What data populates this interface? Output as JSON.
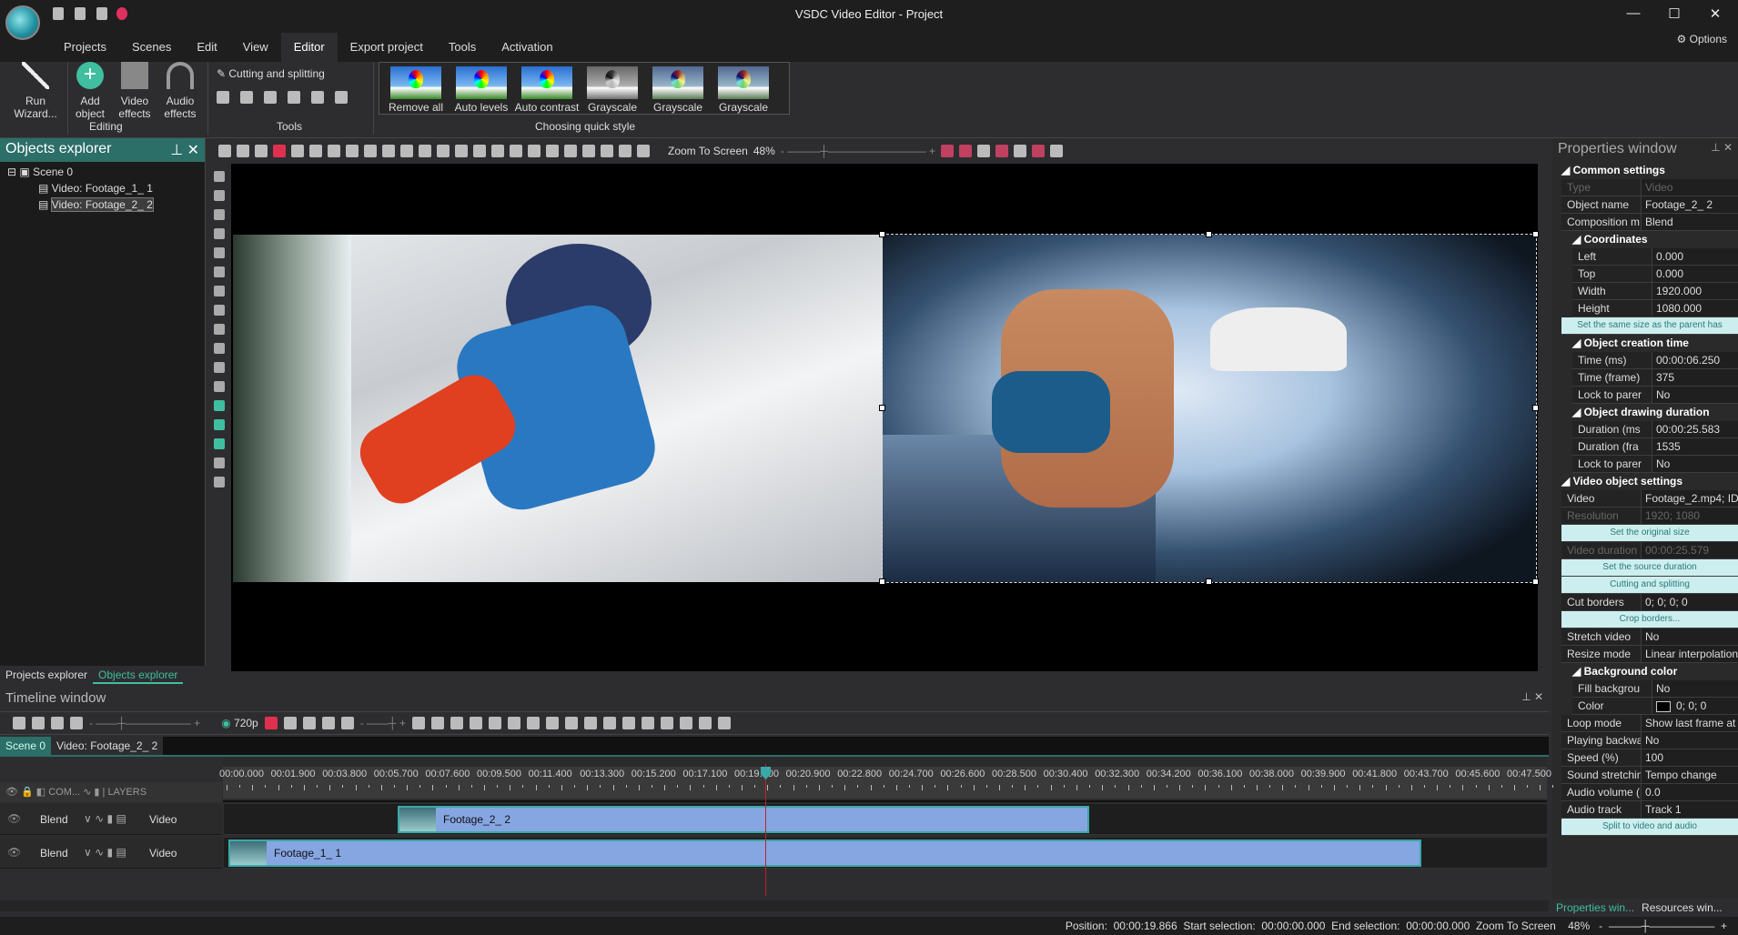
{
  "app": {
    "title": "VSDC Video Editor - Project",
    "options": "Options"
  },
  "menu": [
    "Projects",
    "Scenes",
    "Edit",
    "View",
    "Editor",
    "Export project",
    "Tools",
    "Activation"
  ],
  "menu_active": "Editor",
  "ribbon": {
    "run_wizard": "Run Wizard...",
    "add_object": "Add object",
    "video_effects": "Video effects",
    "audio_effects": "Audio effects",
    "editing": "Editing",
    "cutting": "Cutting and splitting",
    "tools": "Tools",
    "quick_styles": [
      "Remove all",
      "Auto levels",
      "Auto contrast",
      "Grayscale",
      "Grayscale",
      "Grayscale"
    ],
    "choosing": "Choosing quick style"
  },
  "objects_explorer": {
    "title": "Objects explorer",
    "tree": [
      "Scene 0",
      "Video: Footage_1_ 1",
      "Video: Footage_2_ 2"
    ],
    "tabs": [
      "Projects explorer",
      "Objects explorer"
    ]
  },
  "canvas_toolbar": {
    "zoom_label": "Zoom To Screen",
    "zoom": "48%"
  },
  "properties": {
    "title": "Properties window",
    "rows": [
      {
        "t": "sec",
        "l": "Common settings",
        "i": 0
      },
      {
        "t": "row",
        "k": "Type",
        "v": "Video",
        "dis": true,
        "i": 1
      },
      {
        "t": "row",
        "k": "Object name",
        "v": "Footage_2_ 2",
        "i": 1
      },
      {
        "t": "row",
        "k": "Composition m",
        "v": "Blend",
        "i": 1
      },
      {
        "t": "sec",
        "l": "Coordinates",
        "i": 1
      },
      {
        "t": "row",
        "k": "Left",
        "v": "0.000",
        "i": 2
      },
      {
        "t": "row",
        "k": "Top",
        "v": "0.000",
        "i": 2
      },
      {
        "t": "row",
        "k": "Width",
        "v": "1920.000",
        "i": 2
      },
      {
        "t": "row",
        "k": "Height",
        "v": "1080.000",
        "i": 2
      },
      {
        "t": "btn",
        "l": "Set the same size as the parent has"
      },
      {
        "t": "sec",
        "l": "Object creation time",
        "i": 1
      },
      {
        "t": "row",
        "k": "Time (ms)",
        "v": "00:00:06.250",
        "i": 2
      },
      {
        "t": "row",
        "k": "Time (frame)",
        "v": "375",
        "i": 2
      },
      {
        "t": "row",
        "k": "Lock to parer",
        "v": "No",
        "i": 2
      },
      {
        "t": "sec",
        "l": "Object drawing duration",
        "i": 1
      },
      {
        "t": "row",
        "k": "Duration (ms",
        "v": "00:00:25.583",
        "i": 2
      },
      {
        "t": "row",
        "k": "Duration (fra",
        "v": "1535",
        "i": 2
      },
      {
        "t": "row",
        "k": "Lock to parer",
        "v": "No",
        "i": 2
      },
      {
        "t": "sec",
        "l": "Video object settings",
        "i": 0
      },
      {
        "t": "row",
        "k": "Video",
        "v": "Footage_2.mp4; ID",
        "i": 1
      },
      {
        "t": "row",
        "k": "Resolution",
        "v": "1920; 1080",
        "dis": true,
        "i": 1
      },
      {
        "t": "btn",
        "l": "Set the original size"
      },
      {
        "t": "row",
        "k": "Video duration",
        "v": "00:00:25.579",
        "dis": true,
        "i": 1
      },
      {
        "t": "btn",
        "l": "Set the source duration"
      },
      {
        "t": "btn",
        "l": "Cutting and splitting"
      },
      {
        "t": "row",
        "k": "Cut borders",
        "v": "0; 0; 0; 0",
        "i": 1
      },
      {
        "t": "btn",
        "l": "Crop borders..."
      },
      {
        "t": "row",
        "k": "Stretch video",
        "v": "No",
        "i": 1
      },
      {
        "t": "row",
        "k": "Resize mode",
        "v": "Linear interpolation",
        "i": 1
      },
      {
        "t": "sec",
        "l": "Background color",
        "i": 1
      },
      {
        "t": "row",
        "k": "Fill backgrou",
        "v": "No",
        "i": 2
      },
      {
        "t": "row",
        "k": "Color",
        "v": "0; 0; 0",
        "swatch": "#000000",
        "i": 2
      },
      {
        "t": "row",
        "k": "Loop mode",
        "v": "Show last frame at",
        "i": 1
      },
      {
        "t": "row",
        "k": "Playing backwa",
        "v": "No",
        "i": 1
      },
      {
        "t": "row",
        "k": "Speed (%)",
        "v": "100",
        "i": 1
      },
      {
        "t": "row",
        "k": "Sound stretchin",
        "v": "Tempo change",
        "i": 1
      },
      {
        "t": "row",
        "k": "Audio volume (",
        "v": "0.0",
        "i": 1
      },
      {
        "t": "row",
        "k": "Audio track",
        "v": "Track 1",
        "i": 1
      },
      {
        "t": "btn",
        "l": "Split to video and audio"
      }
    ],
    "tabs": [
      "Properties win...",
      "Resources win..."
    ]
  },
  "timeline": {
    "title": "Timeline window",
    "resolution": "720p",
    "tabs": [
      "Scene 0",
      "Video: Footage_2_ 2"
    ],
    "ruler": [
      "00:00.000",
      "00:01.900",
      "00:03.800",
      "00:05.700",
      "00:07.600",
      "00:09.500",
      "00:11.400",
      "00:13.300",
      "00:15.200",
      "00:17.100",
      "00:19.000",
      "00:20.900",
      "00:22.800",
      "00:24.700",
      "00:26.600",
      "00:28.500",
      "00:30.400",
      "00:32.300",
      "00:34.200",
      "00:36.100",
      "00:38.000",
      "00:39.900",
      "00:41.800",
      "00:43.700",
      "00:45.600",
      "00:47.500"
    ],
    "header": {
      "com": "COM...",
      "layers": "LAYERS"
    },
    "tracks": [
      {
        "blend": "Blend",
        "type": "Video",
        "clip": "Footage_2_ 2"
      },
      {
        "blend": "Blend",
        "type": "Video",
        "clip": "Footage_1_ 1"
      }
    ]
  },
  "status": {
    "position_label": "Position:",
    "position": "00:00:19.866",
    "start_label": "Start selection:",
    "start": "00:00:00.000",
    "end_label": "End selection:",
    "end": "00:00:00.000",
    "zoom_label": "Zoom To Screen",
    "zoom": "48%"
  },
  "colors": {
    "accent": "#2c6e68",
    "clip": "#86a6e2",
    "playhead": "#c0202a"
  }
}
